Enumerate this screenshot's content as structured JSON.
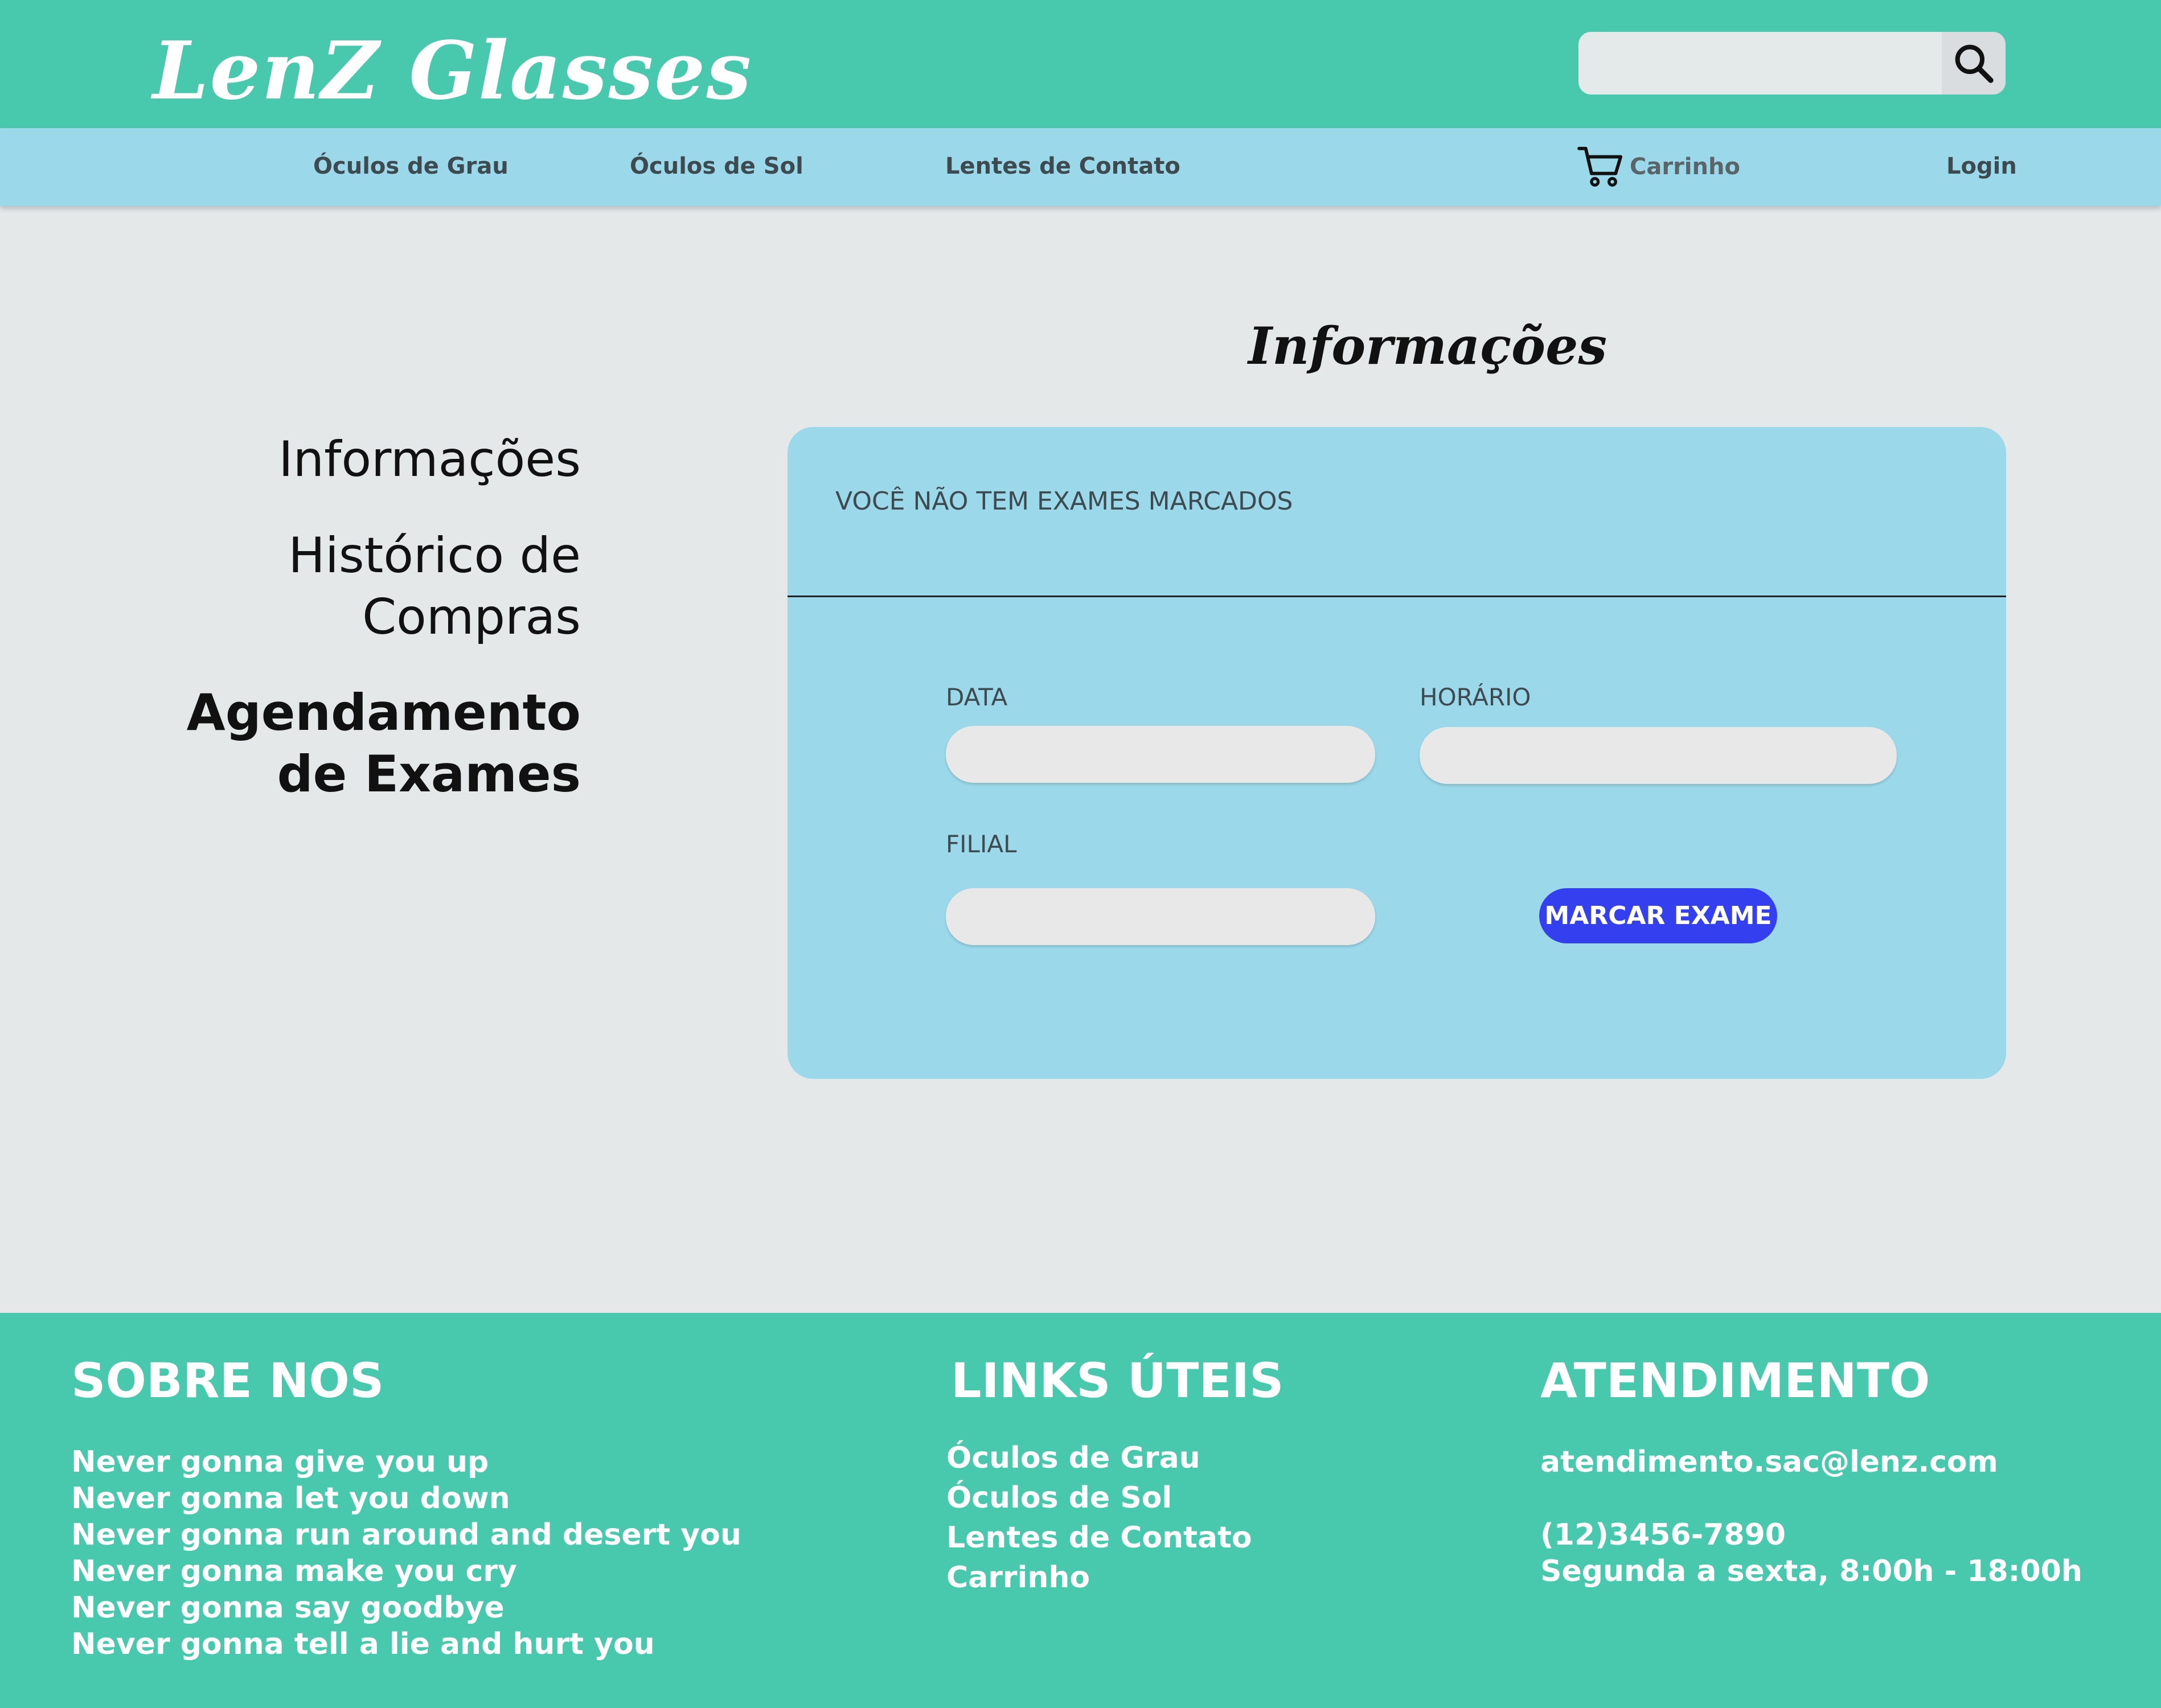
{
  "header": {
    "logo": "LenZ Glasses",
    "search_placeholder": ""
  },
  "nav": {
    "items": [
      "Óculos de Grau",
      "Óculos de Sol",
      "Lentes de Contato"
    ],
    "cart": "Carrinho",
    "login": "Login"
  },
  "sidebar": {
    "info": "Informações",
    "history_line1": "Histórico de",
    "history_line2": "Compras",
    "exams_line1": "Agendamento",
    "exams_line2": "de Exames"
  },
  "main": {
    "title": "Informações",
    "no_exams": "VOCÊ NÃO TEM EXAMES MARCADOS",
    "fields": {
      "date_label": "DATA",
      "time_label": "HORÁRIO",
      "branch_label": "FILIAL"
    },
    "submit": "MARCAR EXAME"
  },
  "footer": {
    "about": {
      "title": "SOBRE NOS",
      "lines": [
        "Never gonna give you up",
        "Never gonna let you down",
        "Never gonna run around and desert you",
        "Never gonna make you cry",
        "Never gonna say goodbye",
        "Never gonna tell a lie and hurt you"
      ]
    },
    "links": {
      "title": "LINKS ÚTEIS",
      "items": [
        "Óculos de Grau",
        "Óculos de Sol",
        "Lentes de Contato",
        "Carrinho"
      ]
    },
    "support": {
      "title": "ATENDIMENTO",
      "email": "atendimento.sac@lenz.com",
      "phone": "(12)3456-7890",
      "hours": "Segunda a sexta, 8:00h - 18:00h"
    }
  },
  "colors": {
    "header_bg": "#48c9ae",
    "nav_bg": "#9bd9ea",
    "page_bg": "#e4e8e9",
    "button_bg": "#3440f0"
  },
  "icons": [
    "search-icon",
    "cart-icon"
  ]
}
